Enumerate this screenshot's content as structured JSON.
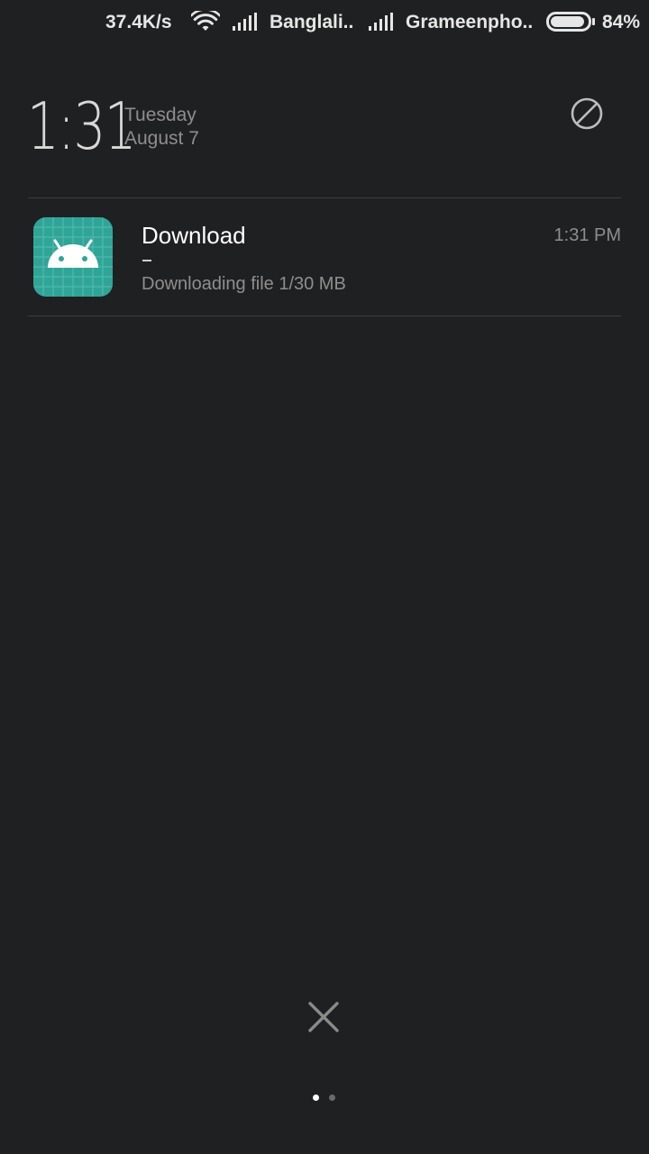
{
  "status_bar": {
    "network_speed": "37.4K/s",
    "carrier1": "Banglali..",
    "carrier2": "Grameenpho..",
    "battery_percent": "84%",
    "battery_level": 0.84
  },
  "header": {
    "time": "1:31",
    "day": "Tuesday",
    "date": "August 7"
  },
  "notifications": [
    {
      "app_icon": "android-icon",
      "title": "Download",
      "time": "1:31 PM",
      "progress_mark": "–",
      "text": "Downloading file 1/30 MB"
    }
  ],
  "controls": {
    "dnd_icon": "do-not-disturb-icon",
    "clear_icon": "close-icon"
  },
  "colors": {
    "background": "#1f2022",
    "app_icon_bg": "#2fa598"
  }
}
